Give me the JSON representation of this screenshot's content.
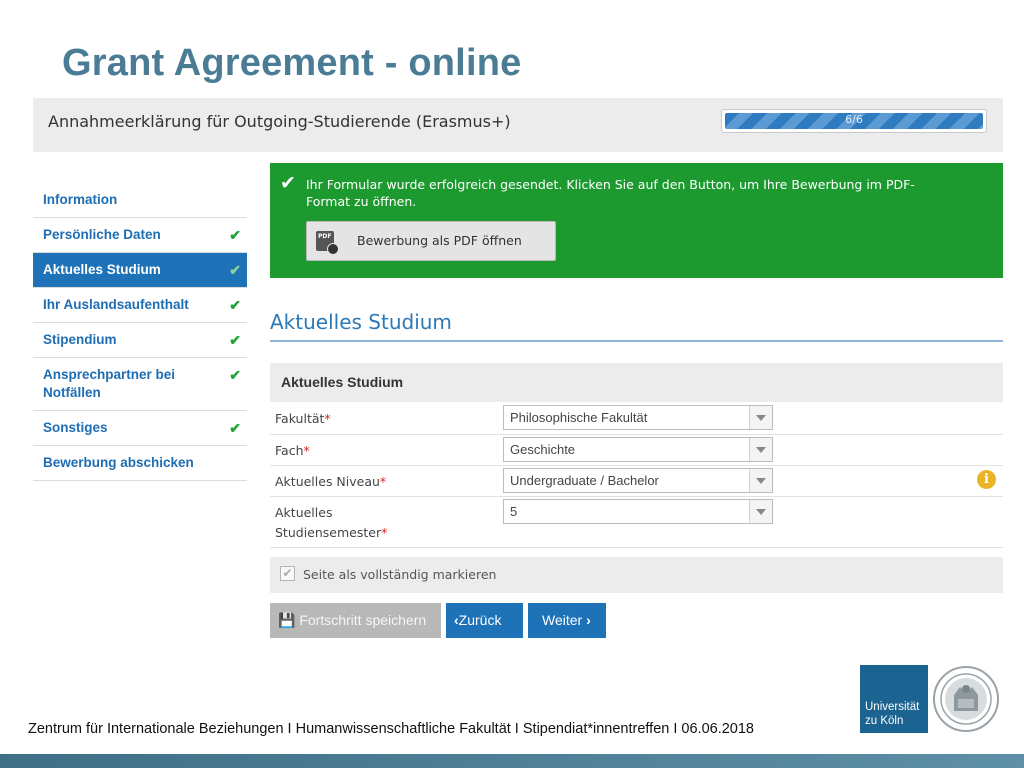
{
  "slide": {
    "title": "Grant Agreement - online",
    "footer": "Zentrum für Internationale Beziehungen I Humanwissenschaftliche Fakultät I Stipendiat*innentreffen I 06.06.2018",
    "logo": {
      "line1": "Universität",
      "line2": "zu Köln"
    }
  },
  "app": {
    "form_title": "Annahmeerklärung für Outgoing-Studierende (Erasmus+)",
    "progress": {
      "label": "6/6",
      "fraction": 1.0
    }
  },
  "sidebar": {
    "items": [
      {
        "label": "Information",
        "checked": false,
        "active": false
      },
      {
        "label": "Persönliche Daten",
        "checked": true,
        "active": false
      },
      {
        "label": "Aktuelles Studium",
        "checked": true,
        "active": true
      },
      {
        "label": "Ihr Auslandsaufenthalt",
        "checked": true,
        "active": false
      },
      {
        "label": "Stipendium",
        "checked": true,
        "active": false
      },
      {
        "label": "Ansprechpartner bei Notfällen",
        "checked": true,
        "active": false
      },
      {
        "label": "Sonstiges",
        "checked": true,
        "active": false
      },
      {
        "label": "Bewerbung abschicken",
        "checked": false,
        "active": false
      }
    ],
    "check_glyph": "✔"
  },
  "success": {
    "message": "Ihr Formular wurde erfolgreich gesendet. Klicken Sie auf den Button, um Ihre Bewerbung im PDF-Format zu öffnen.",
    "pdf_button": "Bewerbung als PDF öffnen",
    "pdf_icon_text": "PDF"
  },
  "main": {
    "heading": "Aktuelles Studium",
    "panel_title": "Aktuelles Studium",
    "required_mark": "*",
    "fields": [
      {
        "label": "Fakultät",
        "value": "Philosophische Fakultät"
      },
      {
        "label": "Fach",
        "value": "Geschichte"
      },
      {
        "label": "Aktuelles Niveau",
        "value": "Undergraduate / Bachelor"
      },
      {
        "label_line1": "Aktuelles",
        "label_line2": "Studiensemester",
        "value": "5"
      }
    ],
    "info_glyph": "i",
    "complete_label": "Seite als vollständig markieren",
    "complete_checked": true
  },
  "buttons": {
    "save": "Fortschritt speichern",
    "back": "Zurück",
    "next": "Weiter"
  },
  "colors": {
    "title": "#4a7c95",
    "primary": "#1d72b8",
    "success": "#1c9a2f",
    "check": "#22a33a",
    "info": "#e9b526",
    "logo": "#1b6390"
  }
}
